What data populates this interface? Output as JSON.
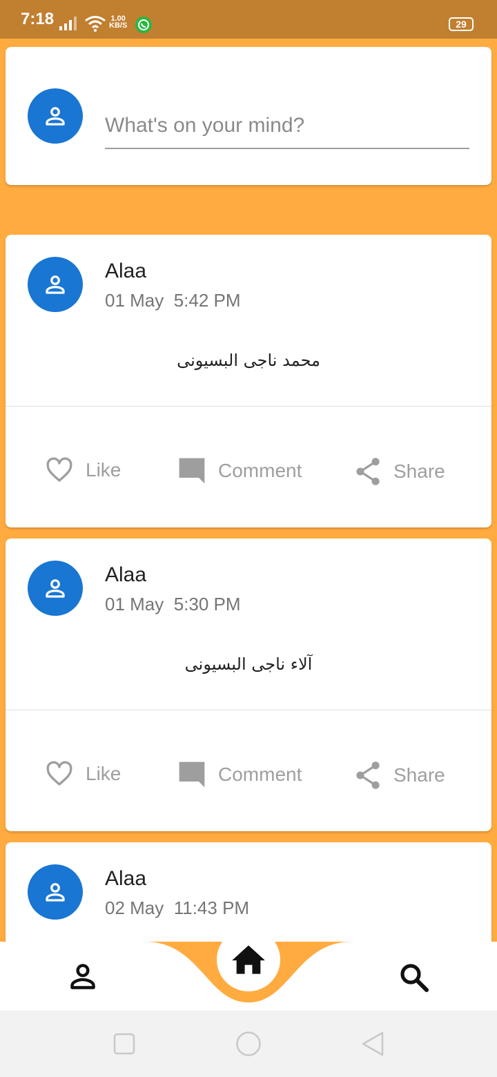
{
  "status_bar": {
    "time": "7:18",
    "speed_value": "1.00",
    "speed_unit": "KB/S",
    "battery": "29",
    "icons": [
      "signal-icon",
      "wifi-icon",
      "whatsapp-icon"
    ]
  },
  "composer": {
    "placeholder": "What's on your mind?"
  },
  "actions": {
    "like": "Like",
    "comment": "Comment",
    "share": "Share"
  },
  "posts": [
    {
      "author": "Alaa",
      "date": "01 May",
      "time": "5:42 PM",
      "content": "محمد ناجى البسيونى"
    },
    {
      "author": "Alaa",
      "date": "01 May",
      "time": "5:30 PM",
      "content": "آلاء ناجى البسيونى"
    },
    {
      "author": "Alaa",
      "date": "02 May",
      "time": "11:43 PM"
    }
  ],
  "bottom_nav": {
    "items": [
      "profile-icon",
      "home-icon",
      "search-icon"
    ],
    "accent": "#FFAB40"
  },
  "colors": {
    "background": "#FFAB40",
    "status_bar": "#C17F30",
    "avatar": "#1976D2",
    "muted": "#9E9E9E"
  }
}
